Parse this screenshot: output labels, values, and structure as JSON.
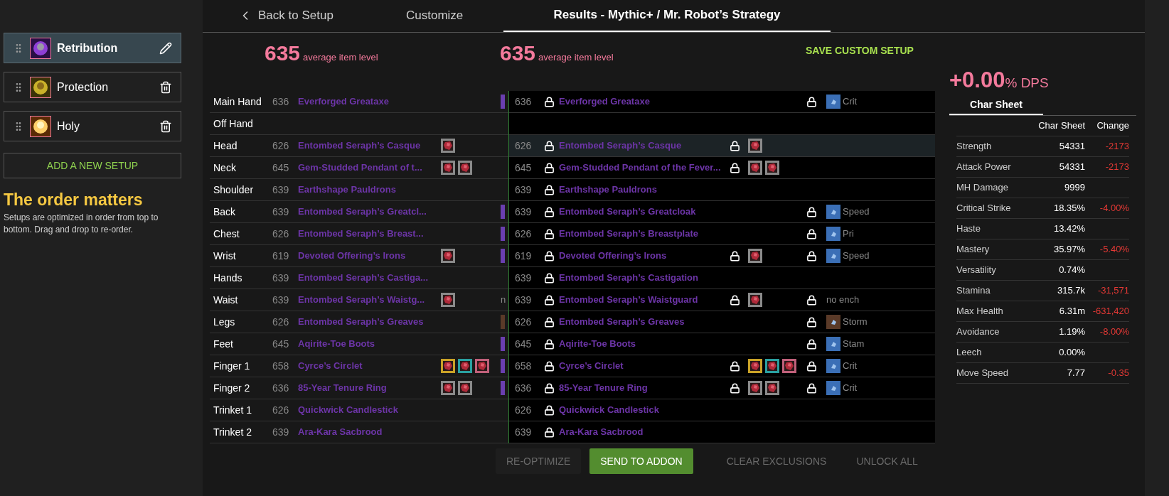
{
  "setups": [
    {
      "name": "Retribution",
      "selected": true
    },
    {
      "name": "Protection",
      "selected": false
    },
    {
      "name": "Holy",
      "selected": false
    }
  ],
  "add_setup": "ADD A NEW SETUP",
  "order_title": "The order matters",
  "order_text": "Setups are optimized in order from top to bottom. Drag and drop to re-order.",
  "tabs": [
    {
      "label": "Back to Setup",
      "kind": "back",
      "selected": false
    },
    {
      "label": "Customize",
      "kind": "plain",
      "selected": false
    },
    {
      "label": "Results - Mythic+ / Mr. Robot’s Strategy",
      "kind": "plain",
      "selected": true
    }
  ],
  "ilvl_left": {
    "value": "635",
    "label": "average item level"
  },
  "ilvl_right": {
    "value": "635",
    "label": "average item level"
  },
  "save_custom": "SAVE CUSTOM SETUP",
  "rows": [
    {
      "slot": "Main Hand",
      "left": {
        "ilvl": "636",
        "name": "Everforged Greataxe",
        "enchant": {
          "color": "#6a3fb0"
        }
      },
      "right": {
        "ilvl": "636",
        "name": "Everforged Greataxe",
        "enchant": {
          "text": "Crit",
          "color": "#3b6fb6"
        }
      },
      "selected": false
    },
    {
      "slot": "Off Hand",
      "selected": false
    },
    {
      "slot": "Head",
      "left": {
        "ilvl": "626",
        "name": "Entombed Seraph’s Casque",
        "gems": [
          {
            "color": "#8a8a8a"
          }
        ]
      },
      "right": {
        "ilvl": "626",
        "name": "Entombed Seraph’s Casque",
        "gems": [
          {
            "color": "#8a8a8a"
          }
        ]
      },
      "selected": true
    },
    {
      "slot": "Neck",
      "left": {
        "ilvl": "645",
        "name": "Gem-Studded Pendant of t...",
        "gems": [
          {
            "color": "#8a8a8a"
          },
          {
            "color": "#8a8a8a"
          }
        ]
      },
      "right": {
        "ilvl": "645",
        "name": "Gem-Studded Pendant of the Fever...",
        "gems": [
          {
            "color": "#8a8a8a"
          },
          {
            "color": "#8a8a8a"
          }
        ]
      },
      "selected": false
    },
    {
      "slot": "Shoulder",
      "left": {
        "ilvl": "639",
        "name": "Earthshape Pauldrons"
      },
      "right": {
        "ilvl": "639",
        "name": "Earthshape Pauldrons"
      },
      "selected": false
    },
    {
      "slot": "Back",
      "left": {
        "ilvl": "639",
        "name": "Entombed Seraph’s Greatcl...",
        "enchant": {
          "color": "#6a3fb0"
        }
      },
      "right": {
        "ilvl": "639",
        "name": "Entombed Seraph’s Greatcloak",
        "enchant": {
          "text": "Speed",
          "color": "#3b6fb6"
        }
      },
      "selected": false
    },
    {
      "slot": "Chest",
      "left": {
        "ilvl": "626",
        "name": "Entombed Seraph’s Breast...",
        "enchant": {
          "color": "#6a3fb0"
        }
      },
      "right": {
        "ilvl": "626",
        "name": "Entombed Seraph’s Breastplate",
        "enchant": {
          "text": "Pri",
          "color": "#3b6fb6"
        }
      },
      "selected": false
    },
    {
      "slot": "Wrist",
      "left": {
        "ilvl": "619",
        "name": "Devoted Offering’s Irons",
        "gems": [
          {
            "color": "#8a8a8a"
          }
        ],
        "enchant": {
          "color": "#6a3fb0"
        }
      },
      "right": {
        "ilvl": "619",
        "name": "Devoted Offering’s Irons",
        "gems": [
          {
            "color": "#8a8a8a"
          }
        ],
        "enchant": {
          "text": "Speed",
          "color": "#3b6fb6"
        }
      },
      "selected": false
    },
    {
      "slot": "Hands",
      "left": {
        "ilvl": "639",
        "name": "Entombed Seraph’s Castiga..."
      },
      "right": {
        "ilvl": "639",
        "name": "Entombed Seraph’s Castigation"
      },
      "selected": false
    },
    {
      "slot": "Waist",
      "left": {
        "ilvl": "639",
        "name": "Entombed Seraph’s Waistg...",
        "gems": [
          {
            "color": "#8a8a8a"
          }
        ],
        "enchant": {
          "text": "n"
        }
      },
      "right": {
        "ilvl": "639",
        "name": "Entombed Seraph’s Waistguard",
        "gems": [
          {
            "color": "#8a8a8a"
          }
        ],
        "enchant": {
          "text": "no ench"
        }
      },
      "selected": false
    },
    {
      "slot": "Legs",
      "left": {
        "ilvl": "626",
        "name": "Entombed Seraph’s Greaves",
        "enchant": {
          "color": "#5a3a28"
        }
      },
      "right": {
        "ilvl": "626",
        "name": "Entombed Seraph’s Greaves",
        "enchant": {
          "text": "Storm",
          "color": "#5a3a28"
        }
      },
      "selected": false
    },
    {
      "slot": "Feet",
      "left": {
        "ilvl": "645",
        "name": "Aqirite-Toe Boots",
        "enchant": {
          "color": "#6a3fb0"
        }
      },
      "right": {
        "ilvl": "645",
        "name": "Aqirite-Toe Boots",
        "enchant": {
          "text": "Stam",
          "color": "#3b6fb6"
        }
      },
      "selected": false
    },
    {
      "slot": "Finger 1",
      "left": {
        "ilvl": "658",
        "name": "Cyrce’s Circlet",
        "gems": [
          {
            "color": "#c9a227"
          },
          {
            "color": "#2aa0a0"
          },
          {
            "color": "#c0607a"
          }
        ],
        "enchant": {
          "color": "#6a3fb0"
        }
      },
      "right": {
        "ilvl": "658",
        "name": "Cyrce’s Circlet",
        "gems": [
          {
            "color": "#c9a227"
          },
          {
            "color": "#2aa0a0"
          },
          {
            "color": "#c0607a"
          }
        ],
        "enchant": {
          "text": "Crit",
          "color": "#3b6fb6"
        }
      },
      "selected": false
    },
    {
      "slot": "Finger 2",
      "left": {
        "ilvl": "636",
        "name": "85-Year Tenure Ring",
        "gems": [
          {
            "color": "#8a8a8a"
          },
          {
            "color": "#8a8a8a"
          }
        ],
        "enchant": {
          "color": "#6a3fb0"
        }
      },
      "right": {
        "ilvl": "636",
        "name": "85-Year Tenure Ring",
        "gems": [
          {
            "color": "#8a8a8a"
          },
          {
            "color": "#8a8a8a"
          }
        ],
        "enchant": {
          "text": "Crit",
          "color": "#3b6fb6"
        }
      },
      "selected": false
    },
    {
      "slot": "Trinket 1",
      "left": {
        "ilvl": "626",
        "name": "Quickwick Candlestick"
      },
      "right": {
        "ilvl": "626",
        "name": "Quickwick Candlestick"
      },
      "selected": false
    },
    {
      "slot": "Trinket 2",
      "left": {
        "ilvl": "639",
        "name": "Ara-Kara Sacbrood"
      },
      "right": {
        "ilvl": "639",
        "name": "Ara-Kara Sacbrood"
      },
      "selected": false
    }
  ],
  "dps": {
    "value": "+0.00",
    "unit": "% DPS"
  },
  "stats_tab": {
    "label": "Char Sheet",
    "selected": true
  },
  "stats_columns": [
    "Char Sheet",
    "Change"
  ],
  "stats": [
    {
      "name": "Strength",
      "value": "54331",
      "change": "-2173"
    },
    {
      "name": "Attack Power",
      "value": "54331",
      "change": "-2173"
    },
    {
      "name": "MH Damage",
      "value": "9999"
    },
    {
      "name": "Critical Strike",
      "value": "18.35%",
      "change": "-4.00%"
    },
    {
      "name": "Haste",
      "value": "13.42%"
    },
    {
      "name": "Mastery",
      "value": "35.97%",
      "change": "-5.40%"
    },
    {
      "name": "Versatility",
      "value": "0.74%"
    },
    {
      "name": "Stamina",
      "value": "315.7k",
      "change": "-31,571"
    },
    {
      "name": "Max Health",
      "value": "6.31m",
      "change": "-631,420"
    },
    {
      "name": "Avoidance",
      "value": "1.19%",
      "change": "-8.00%"
    },
    {
      "name": "Leech",
      "value": "0.00%"
    },
    {
      "name": "Move Speed",
      "value": "7.77",
      "change": "-0.35"
    }
  ],
  "actions": [
    {
      "label": "RE-OPTIMIZE",
      "kind": "boxed",
      "disabled": true
    },
    {
      "label": "SEND TO ADDON",
      "kind": "primary",
      "disabled": false
    },
    {
      "label": "CLEAR EXCLUSIONS",
      "kind": "text",
      "disabled": true
    },
    {
      "label": "UNLOCK ALL",
      "kind": "text",
      "disabled": true
    }
  ]
}
